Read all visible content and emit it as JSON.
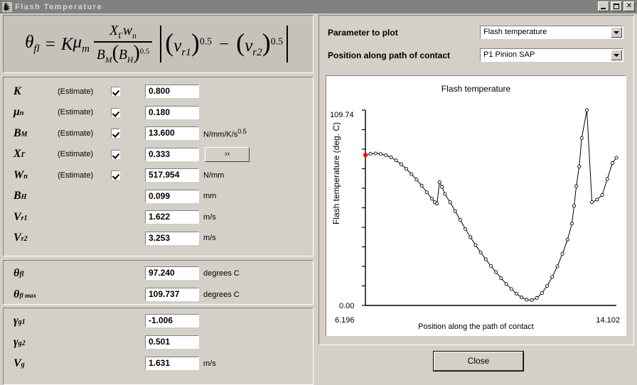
{
  "window": {
    "title": "Flash Temperature",
    "icon": "app-icon",
    "minimize_label": "_",
    "maximize_label": "□",
    "close_label": "✕"
  },
  "equation": {
    "lhs": "θ",
    "lhs_sub": "fl",
    "eq": "=",
    "k": "K",
    "mu": "μ",
    "mu_sub": "m",
    "num_x": "X",
    "num_x_sub": "Γ",
    "num_w": "w",
    "num_w_sub": "n",
    "den_b": "B",
    "den_b_sub": "M",
    "den_bh": "B",
    "den_bh_sub": "H",
    "den_exp": "0.5",
    "v1": "v",
    "v1_sub": "r1",
    "v1_exp": "0.5",
    "minus": "−",
    "v2": "v",
    "v2_sub": "r2",
    "v2_exp": "0.5"
  },
  "inputs": {
    "estimate_label": "(Estimate)",
    "more_button": "››",
    "rows": [
      {
        "sym": "K",
        "sym_sub": "",
        "estimate": true,
        "checked": true,
        "value": "0.800",
        "unit": "",
        "unit_sup": ""
      },
      {
        "sym": "μ",
        "sym_sub": "n",
        "estimate": true,
        "checked": true,
        "value": "0.180",
        "unit": "",
        "unit_sup": ""
      },
      {
        "sym": "B",
        "sym_sub": "M",
        "estimate": true,
        "checked": true,
        "value": "13.600",
        "unit": "N/mm/K/s",
        "unit_sup": "0.5"
      },
      {
        "sym": "X",
        "sym_sub": "Γ",
        "estimate": true,
        "checked": true,
        "value": "0.333",
        "unit": "",
        "unit_sup": "",
        "has_more": true
      },
      {
        "sym": "W",
        "sym_sub": "n",
        "estimate": true,
        "checked": true,
        "value": "517.954",
        "unit": "N/mm",
        "unit_sup": ""
      },
      {
        "sym": "B",
        "sym_sub": "H",
        "estimate": false,
        "checked": false,
        "value": "0.099",
        "unit": "mm",
        "unit_sup": ""
      },
      {
        "sym": "V",
        "sym_sub": "r1",
        "estimate": false,
        "checked": false,
        "value": "1.622",
        "unit": "m/s",
        "unit_sup": ""
      },
      {
        "sym": "V",
        "sym_sub": "r2",
        "estimate": false,
        "checked": false,
        "value": "3.253",
        "unit": "m/s",
        "unit_sup": ""
      }
    ]
  },
  "results_theta": {
    "rows": [
      {
        "sym": "θ",
        "sym_sub": "fl",
        "value": "97.240",
        "unit": "degrees C"
      },
      {
        "sym": "θ",
        "sym_sub": "fl max",
        "value": "109.737",
        "unit": "degrees C"
      }
    ]
  },
  "results_gamma": {
    "rows": [
      {
        "sym": "γ",
        "sym_sub": "g1",
        "value": "-1.006",
        "unit": ""
      },
      {
        "sym": "γ",
        "sym_sub": "g2",
        "value": "0.501",
        "unit": ""
      },
      {
        "sym": "V",
        "sym_sub": "g",
        "value": "1.631",
        "unit": "m/s"
      }
    ]
  },
  "plot_controls": {
    "parameter_label": "Parameter to plot",
    "parameter_value": "Flash temperature",
    "position_label": "Position along path of contact",
    "position_value": "P1 Pinion SAP"
  },
  "footer": {
    "close_label": "Close"
  },
  "chart_data": {
    "type": "line",
    "title": "Flash temperature",
    "xlabel": "Position along the path of contact",
    "ylabel": "Flash temperature (deg. C)",
    "xlim": [
      6.196,
      14.102
    ],
    "ylim": [
      0.0,
      109.74
    ],
    "xtick_labels": [
      "6.196",
      "14.102"
    ],
    "ytick_labels": [
      "0.00",
      "109.74"
    ],
    "y_minor_ticks": 10,
    "grid": false,
    "legend": null,
    "markers": "open-circle",
    "highlight_point": {
      "x": 6.196,
      "y": 84.5,
      "color": "#ff0000"
    },
    "x": [
      6.196,
      6.357,
      6.518,
      6.679,
      6.84,
      7.001,
      7.162,
      7.323,
      7.484,
      7.645,
      7.806,
      7.967,
      8.128,
      8.289,
      8.38,
      8.45,
      8.53,
      8.61,
      8.7,
      8.861,
      9.022,
      9.183,
      9.344,
      9.505,
      9.666,
      9.827,
      9.988,
      10.149,
      10.31,
      10.471,
      10.632,
      10.793,
      10.954,
      11.115,
      11.276,
      11.437,
      11.598,
      11.759,
      11.92,
      12.081,
      12.242,
      12.403,
      12.564,
      12.7,
      12.77,
      12.84,
      12.93,
      13.01,
      13.171,
      13.332,
      13.493,
      13.654,
      13.815,
      13.976,
      14.102
    ],
    "y": [
      84.5,
      85.2,
      85.4,
      85.1,
      84.4,
      83.2,
      81.5,
      79.3,
      76.7,
      73.8,
      70.7,
      67.3,
      63.6,
      60.0,
      58.0,
      57.2,
      69.2,
      66.5,
      62.6,
      58.0,
      53.0,
      48.0,
      43.0,
      38.3,
      33.9,
      29.8,
      25.9,
      22.2,
      18.7,
      15.3,
      12.1,
      9.2,
      6.6,
      4.5,
      3.2,
      3.0,
      4.2,
      7.0,
      11.0,
      16.0,
      22.0,
      29.0,
      37.0,
      46.0,
      56.0,
      67.0,
      78.0,
      94.0,
      109.7,
      58.0,
      59.5,
      62.0,
      71.0,
      80.0,
      83.0
    ],
    "series": [
      {
        "name": "Flash temperature",
        "color": "#000000"
      }
    ]
  }
}
